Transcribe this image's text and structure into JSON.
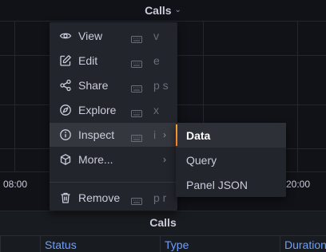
{
  "graph_panel": {
    "title": "Calls",
    "x_ticks": [
      "08:00",
      "20:00"
    ]
  },
  "context_menu": {
    "items": [
      {
        "label": "View",
        "shortcut": "v",
        "icon": "eye-icon"
      },
      {
        "label": "Edit",
        "shortcut": "e",
        "icon": "edit-icon"
      },
      {
        "label": "Share",
        "shortcut": "p s",
        "icon": "share-icon"
      },
      {
        "label": "Explore",
        "shortcut": "x",
        "icon": "compass-icon"
      },
      {
        "label": "Inspect",
        "shortcut": "i",
        "icon": "info-circle-icon",
        "has_submenu": true,
        "active": true
      },
      {
        "label": "More...",
        "shortcut": "",
        "icon": "cube-icon",
        "has_submenu": true
      },
      {
        "label": "Remove",
        "shortcut": "p r",
        "icon": "trash-icon"
      }
    ]
  },
  "inspect_submenu": {
    "items": [
      {
        "label": "Data",
        "active": true
      },
      {
        "label": "Query"
      },
      {
        "label": "Panel JSON"
      }
    ]
  },
  "table_panel": {
    "title": "Calls",
    "columns": [
      "Status",
      "Type",
      "Duration"
    ]
  },
  "colors": {
    "background": "#111217",
    "menu_background": "#22252b",
    "active_item": "#34373e",
    "table_header_link": "#6e9fff",
    "accent": "#ff7a1a"
  }
}
